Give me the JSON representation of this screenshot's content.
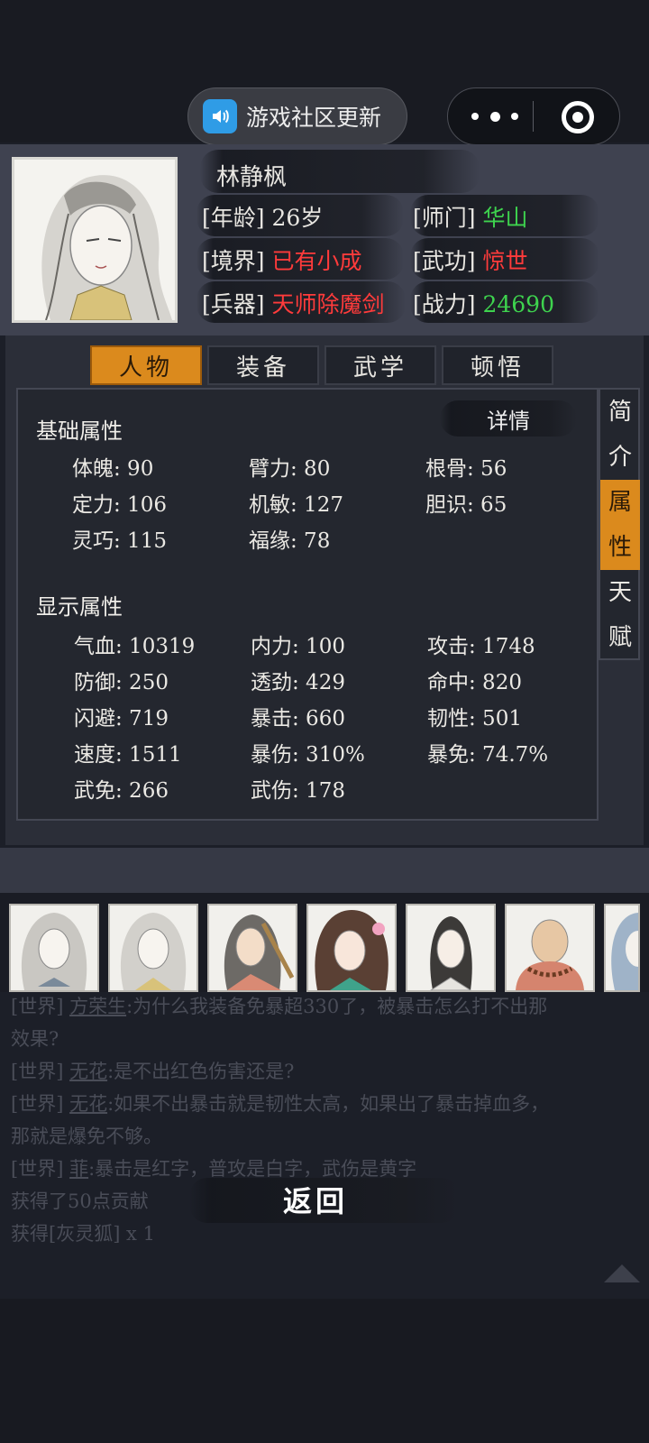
{
  "top": {
    "notice_label": "游戏社区更新"
  },
  "character": {
    "name": "林静枫",
    "age_label": "[年龄]",
    "age_value": "26岁",
    "sect_label": "[师门]",
    "sect_value": "华山",
    "realm_label": "[境界]",
    "realm_value": "已有小成",
    "martial_label": "[武功]",
    "martial_value": "惊世",
    "weapon_label": "[兵器]",
    "weapon_value": "天师除魔剑",
    "power_label": "[战力]",
    "power_value": "24690"
  },
  "tabs": [
    "人物",
    "装备",
    "武学",
    "顿悟"
  ],
  "side_tabs": [
    {
      "chars": [
        "简",
        "介"
      ]
    },
    {
      "chars": [
        "属",
        "性"
      ]
    },
    {
      "chars": [
        "天",
        "赋"
      ]
    }
  ],
  "detail_label": "详情",
  "basic": {
    "title": "基础属性",
    "items": [
      "体魄: 90",
      "臂力: 80",
      "根骨: 56",
      "定力: 106",
      "机敏: 127",
      "胆识: 65",
      "灵巧: 115",
      "福缘: 78"
    ]
  },
  "display": {
    "title": "显示属性",
    "items": [
      "气血: 10319",
      "内力: 100",
      "攻击: 1748",
      "防御: 250",
      "透劲: 429",
      "命中: 820",
      "闪避: 719",
      "暴击: 660",
      "韧性: 501",
      "速度: 1511",
      "暴伤: 310%",
      "暴免: 74.7%",
      "武免: 266",
      "武伤: 178"
    ]
  },
  "chat": {
    "l1_tag": "[世界]",
    "l1_user": "方荣生",
    "l1_text": ":为什么我装备免暴超330了，被暴击怎么打不出那",
    "l2_text": "效果?",
    "l3_tag": "[世界]",
    "l3_user": "无花",
    "l3_text": ":是不出红色伤害还是?",
    "l4_tag": "[世界]",
    "l4_user": "无花",
    "l4_text": ":如果不出暴击就是韧性太高，如果出了暴击掉血多，",
    "l5_text": "那就是爆免不够。",
    "l6_tag": "[世界]",
    "l6_user": "菲",
    "l6_text": ":暴击是红字，普攻是白字，武伤是黄字",
    "l7_text": "获得了50点",
    "l7_extra": "贡献",
    "l8_text": "获得[灰灵狐] x 1"
  },
  "back_label": "返回",
  "colors": {
    "accent": "#db8a1d",
    "green": "#3ed34e",
    "red": "#ff3b3b"
  }
}
